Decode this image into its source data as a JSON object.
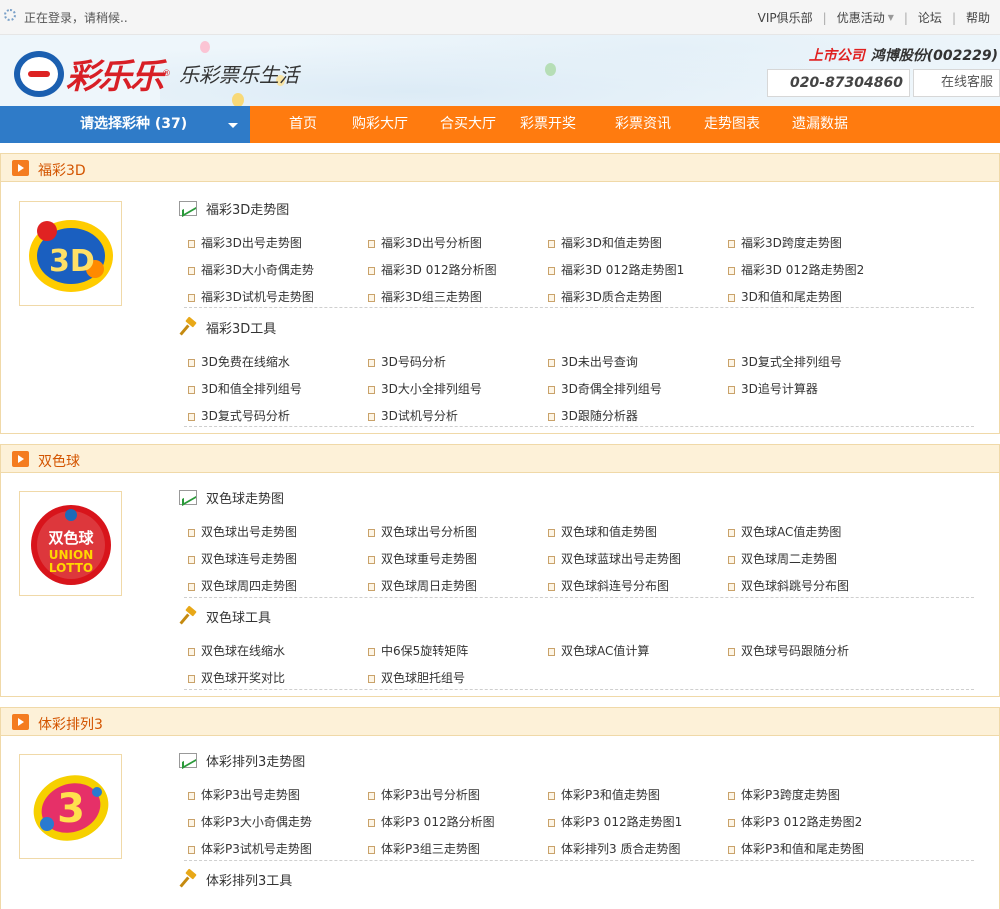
{
  "topbar": {
    "status": "正在登录，请稍候..",
    "links": [
      "VIP俱乐部",
      "优惠活动",
      "论坛",
      "帮助"
    ]
  },
  "header": {
    "brand": "彩乐乐",
    "slogan": "乐彩票乐生活",
    "listed_label": "上市公司",
    "listed_company": "鸿博股份(002229)",
    "phone": "020-87304860",
    "service": "在线客服"
  },
  "nav": {
    "select_label": "请选择彩种 (37)",
    "items": [
      "首页",
      "购彩大厅",
      "合买大厅",
      "彩票开奖",
      "彩票资讯",
      "走势图表",
      "遗漏数据"
    ]
  },
  "sections": [
    {
      "title": "福彩3D",
      "chart_title": "福彩3D走势图",
      "chart_links": [
        [
          "福彩3D出号走势图",
          "福彩3D出号分析图",
          "福彩3D和值走势图",
          "福彩3D跨度走势图"
        ],
        [
          "福彩3D大小奇偶走势",
          "福彩3D 012路分析图",
          "福彩3D 012路走势图1",
          "福彩3D 012路走势图2"
        ],
        [
          "福彩3D试机号走势图",
          "福彩3D组三走势图",
          "福彩3D质合走势图",
          "3D和值和尾走势图"
        ]
      ],
      "tool_title": "福彩3D工具",
      "tool_links": [
        [
          "3D免费在线缩水",
          "3D号码分析",
          "3D未出号查询",
          "3D复式全排列组号"
        ],
        [
          "3D和值全排列组号",
          "3D大小全排列组号",
          "3D奇偶全排列组号",
          "3D追号计算器"
        ],
        [
          "3D复式号码分析",
          "3D试机号分析",
          "3D跟随分析器"
        ]
      ]
    },
    {
      "title": "双色球",
      "chart_title": "双色球走势图",
      "chart_links": [
        [
          "双色球出号走势图",
          "双色球出号分析图",
          "双色球和值走势图",
          "双色球AC值走势图"
        ],
        [
          "双色球连号走势图",
          "双色球重号走势图",
          "双色球蓝球出号走势图",
          "双色球周二走势图"
        ],
        [
          "双色球周四走势图",
          "双色球周日走势图",
          "双色球斜连号分布图",
          "双色球斜跳号分布图"
        ]
      ],
      "tool_title": "双色球工具",
      "tool_links": [
        [
          "双色球在线缩水",
          "中6保5旋转矩阵",
          "双色球AC值计算",
          "双色球号码跟随分析"
        ],
        [
          "双色球开奖对比",
          "双色球胆托组号"
        ]
      ]
    },
    {
      "title": "体彩排列3",
      "chart_title": "体彩排列3走势图",
      "chart_links": [
        [
          "体彩P3出号走势图",
          "体彩P3出号分析图",
          "体彩P3和值走势图",
          "体彩P3跨度走势图"
        ],
        [
          "体彩P3大小奇偶走势",
          "体彩P3 012路分析图",
          "体彩P3 012路走势图1",
          "体彩P3 012路走势图2"
        ],
        [
          "体彩P3试机号走势图",
          "体彩P3组三走势图",
          "体彩排列3 质合走势图",
          "体彩P3和值和尾走势图"
        ]
      ],
      "tool_title": "体彩排列3工具"
    }
  ],
  "logos": {
    "s0": "3D",
    "s1_top": "双色球",
    "s1_mid": "UNION",
    "s1_bot": "LOTTO",
    "s2": "3"
  },
  "colors": {
    "nav_orange": "#ff7b0f",
    "nav_blue": "#2f7bc8",
    "brand_red": "#d81f26"
  }
}
